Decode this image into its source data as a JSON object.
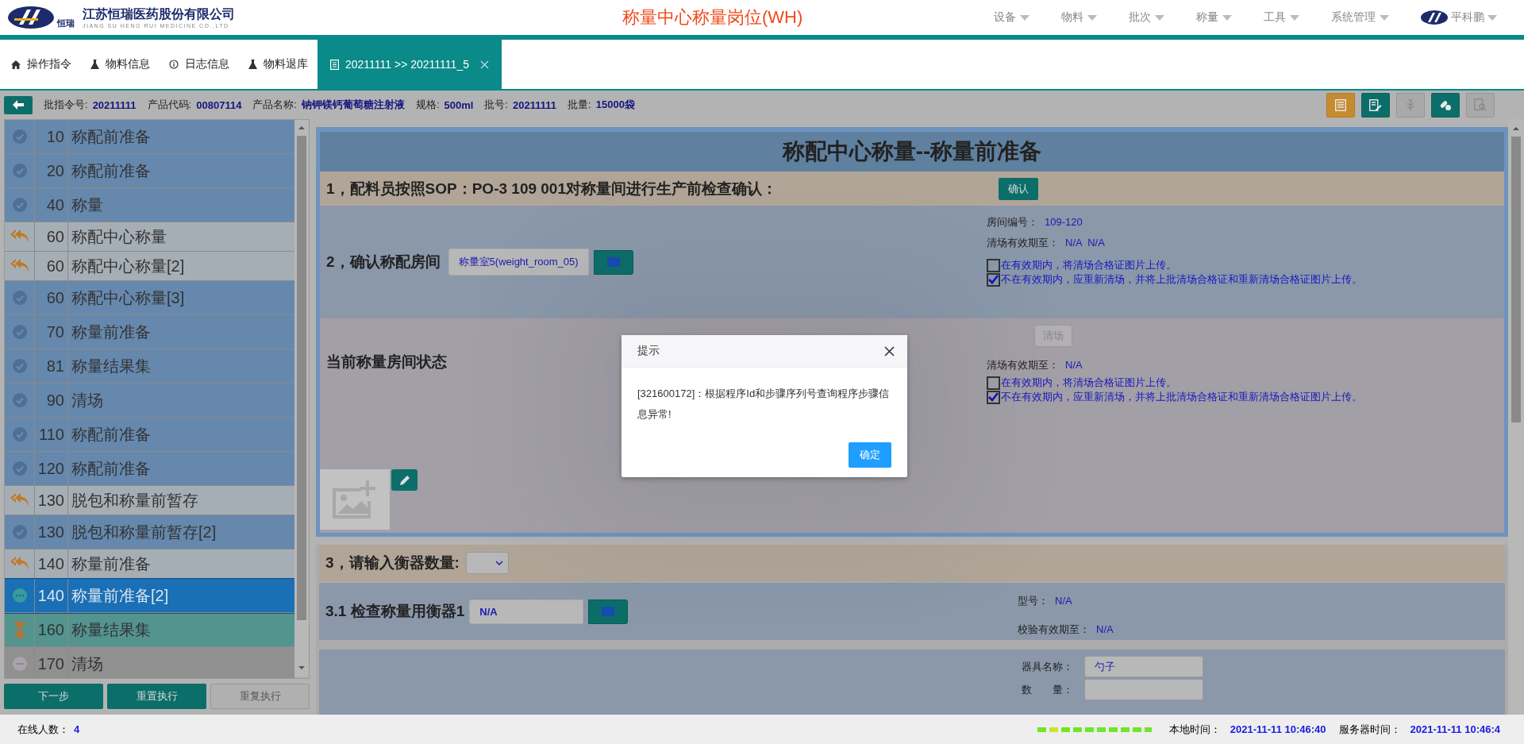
{
  "header": {
    "logo_mark": "恒瑞",
    "company": "江苏恒瑞医药股份有限公司",
    "company_en": "JIANG SU HENG RUI MEDICINE CO.,LTD",
    "title": "称量中心称量岗位(WH)",
    "menus": [
      "设备",
      "物料",
      "批次",
      "称量",
      "工具",
      "系统管理"
    ],
    "user": "平科鹏"
  },
  "tabs": [
    {
      "label": "操作指令",
      "kind": "home",
      "selected": false,
      "closable": false
    },
    {
      "label": "物料信息",
      "kind": "flask",
      "selected": false,
      "closable": false
    },
    {
      "label": "日志信息",
      "kind": "info",
      "selected": false,
      "closable": false
    },
    {
      "label": "物料退库",
      "kind": "flask",
      "selected": false,
      "closable": false
    },
    {
      "label": "20211111 >> 20211111_5",
      "kind": "doc",
      "selected": true,
      "closable": true
    }
  ],
  "info_bar": {
    "fields": [
      {
        "label": "批指令号:",
        "value": "20211111"
      },
      {
        "label": "产品代码:",
        "value": "00807114"
      },
      {
        "label": "产品名称:",
        "value": "钠钾镁钙葡萄糖注射液"
      },
      {
        "label": "规格:",
        "value": "500ml"
      },
      {
        "label": "批号:",
        "value": "20211111"
      },
      {
        "label": "批量:",
        "value": "15000袋"
      }
    ],
    "actions": [
      {
        "kind": "list",
        "color": "#c68b30",
        "disabled": false
      },
      {
        "kind": "edit",
        "color": "#0c6e69",
        "disabled": false
      },
      {
        "kind": "leaf",
        "color": "#a9a9a9",
        "disabled": true
      },
      {
        "kind": "pills",
        "color": "#0c6e69",
        "disabled": false
      },
      {
        "kind": "search",
        "color": "#a9a9a9",
        "disabled": true
      }
    ]
  },
  "steps": [
    {
      "number": "10",
      "name": "称配前准备",
      "kind": "done",
      "selected": false
    },
    {
      "number": "20",
      "name": "称配前准备",
      "kind": "done",
      "selected": false
    },
    {
      "number": "40",
      "name": "称量",
      "kind": "done",
      "selected": false
    },
    {
      "number": "60",
      "name": "称配中心称量",
      "kind": "returned",
      "selected": false
    },
    {
      "number": "60",
      "name": "称配中心称量[2]",
      "kind": "returned",
      "selected": false
    },
    {
      "number": "60",
      "name": "称配中心称量[3]",
      "kind": "done",
      "selected": false
    },
    {
      "number": "70",
      "name": "称量前准备",
      "kind": "done",
      "selected": false
    },
    {
      "number": "81",
      "name": "称量结果集",
      "kind": "done",
      "selected": false
    },
    {
      "number": "90",
      "name": "清场",
      "kind": "done",
      "selected": false
    },
    {
      "number": "110",
      "name": "称配前准备",
      "kind": "done",
      "selected": false
    },
    {
      "number": "120",
      "name": "称配前准备",
      "kind": "done",
      "selected": false
    },
    {
      "number": "130",
      "name": "脱包和称量前暂存",
      "kind": "returned",
      "selected": false
    },
    {
      "number": "130",
      "name": "脱包和称量前暂存[2]",
      "kind": "done",
      "selected": false
    },
    {
      "number": "140",
      "name": "称量前准备",
      "kind": "returned",
      "selected": false
    },
    {
      "number": "140",
      "name": "称量前准备[2]",
      "kind": "running",
      "selected": true
    },
    {
      "number": "160",
      "name": "称量结果集",
      "kind": "waiting",
      "selected": false
    },
    {
      "number": "170",
      "name": "清场",
      "kind": "pending",
      "selected": false
    }
  ],
  "step_buttons": [
    {
      "label": "下一步",
      "disabled": false
    },
    {
      "label": "重置执行",
      "disabled": false
    },
    {
      "label": "重复执行",
      "disabled": true
    }
  ],
  "form": {
    "title": "称配中心称量--称量前准备",
    "step1": {
      "label": "1，配料员按照SOP：PO-3 109 001对称量间进行生产前检查确认：",
      "button": "确认"
    },
    "step2": {
      "label": "2，确认称配房间",
      "room_value": "称量室5(weight_room_05)",
      "details": [
        {
          "label": "房间编号：",
          "value": "109-120"
        },
        {
          "label": "清场有效期至：",
          "value": "N/A  N/A"
        }
      ],
      "options": [
        {
          "label": "在有效期内，将清场合格证图片上传。",
          "checked": false
        },
        {
          "label": "不在有效期内，应重新清场，并将上批清场合格证和重新清场合格证图片上传。",
          "checked": true
        }
      ]
    },
    "room_status": {
      "label": "当前称量房间状态",
      "button": "清场",
      "button_disabled": true,
      "details": [
        {
          "label": "清场有效期至：",
          "value": "N/A"
        }
      ],
      "options": [
        {
          "label": "在有效期内，将清场合格证图片上传。",
          "checked": false
        },
        {
          "label": "不在有效期内，应重新清场，并将上批清场合格证和重新清场合格证图片上传。",
          "checked": true
        }
      ]
    },
    "step3": {
      "label": "3，请输入衡器数量:"
    },
    "scale_check": {
      "label": "3.1 检查称量用衡器1",
      "value": "N/A",
      "details": [
        {
          "label": "型号：",
          "value": "N/A"
        },
        {
          "label": "校验有效期至：",
          "value": "N/A"
        }
      ]
    },
    "utensil": [
      {
        "label": "器具名称：",
        "value": "勺子"
      },
      {
        "label": "数　　量："
      }
    ]
  },
  "dialog": {
    "title": "提示",
    "message": "[321600172]：根据程序Id和步骤序列号查询程序步骤信息异常!",
    "button": "确定"
  },
  "status_bar": {
    "online_label": "在线人数：",
    "online_count": "4",
    "local_time_label": "本地时间：",
    "local_time": "2021-11-11 10:46:40",
    "server_time_label": "服务器时间：",
    "server_time": "2021-11-11 10:46:4"
  }
}
